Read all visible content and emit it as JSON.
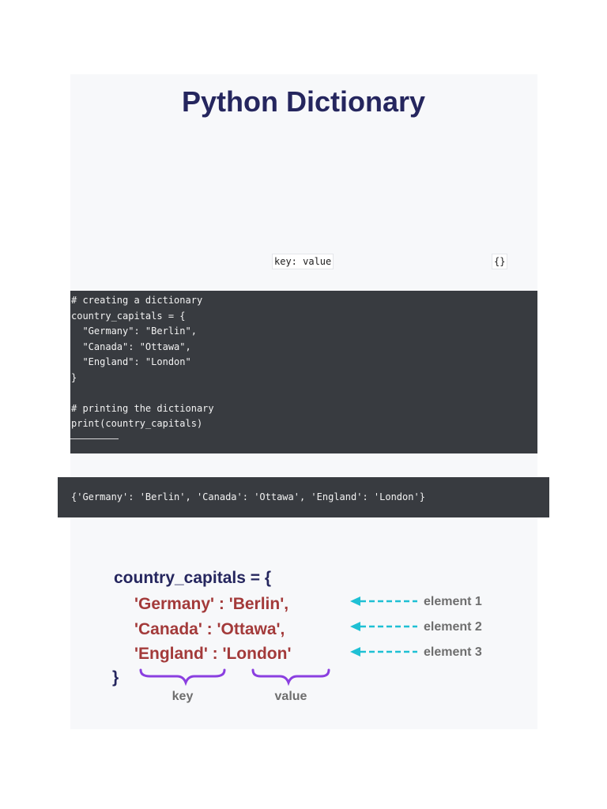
{
  "title": "Python Dictionary",
  "inline_codes": {
    "key_value": "key: value",
    "braces": "{}"
  },
  "code_lines": [
    "# creating a dictionary",
    "country_capitals = {",
    "  \"Germany\": \"Berlin\",",
    "  \"Canada\": \"Ottawa\",",
    "  \"England\": \"London\"",
    "}",
    "",
    "# printing the dictionary",
    "print(country_capitals)"
  ],
  "output_text": "{'Germany': 'Berlin', 'Canada': 'Ottawa', 'England': 'London'}",
  "diagram": {
    "header": "country_capitals = {",
    "rows": [
      {
        "text": "'Germany' : 'Berlin',",
        "label": "element 1"
      },
      {
        "text": "'Canada' : 'Ottawa',",
        "label": "element 2"
      },
      {
        "text": "'England' : 'London'",
        "label": "element 3"
      }
    ],
    "closing": "}",
    "key_label": "key",
    "value_label": "value",
    "colors": {
      "header": "#25265e",
      "entry": "#a33a3a",
      "arrow": "#1fc0d4",
      "brace": "#8b3fe0",
      "label": "#6e6e6e"
    }
  }
}
